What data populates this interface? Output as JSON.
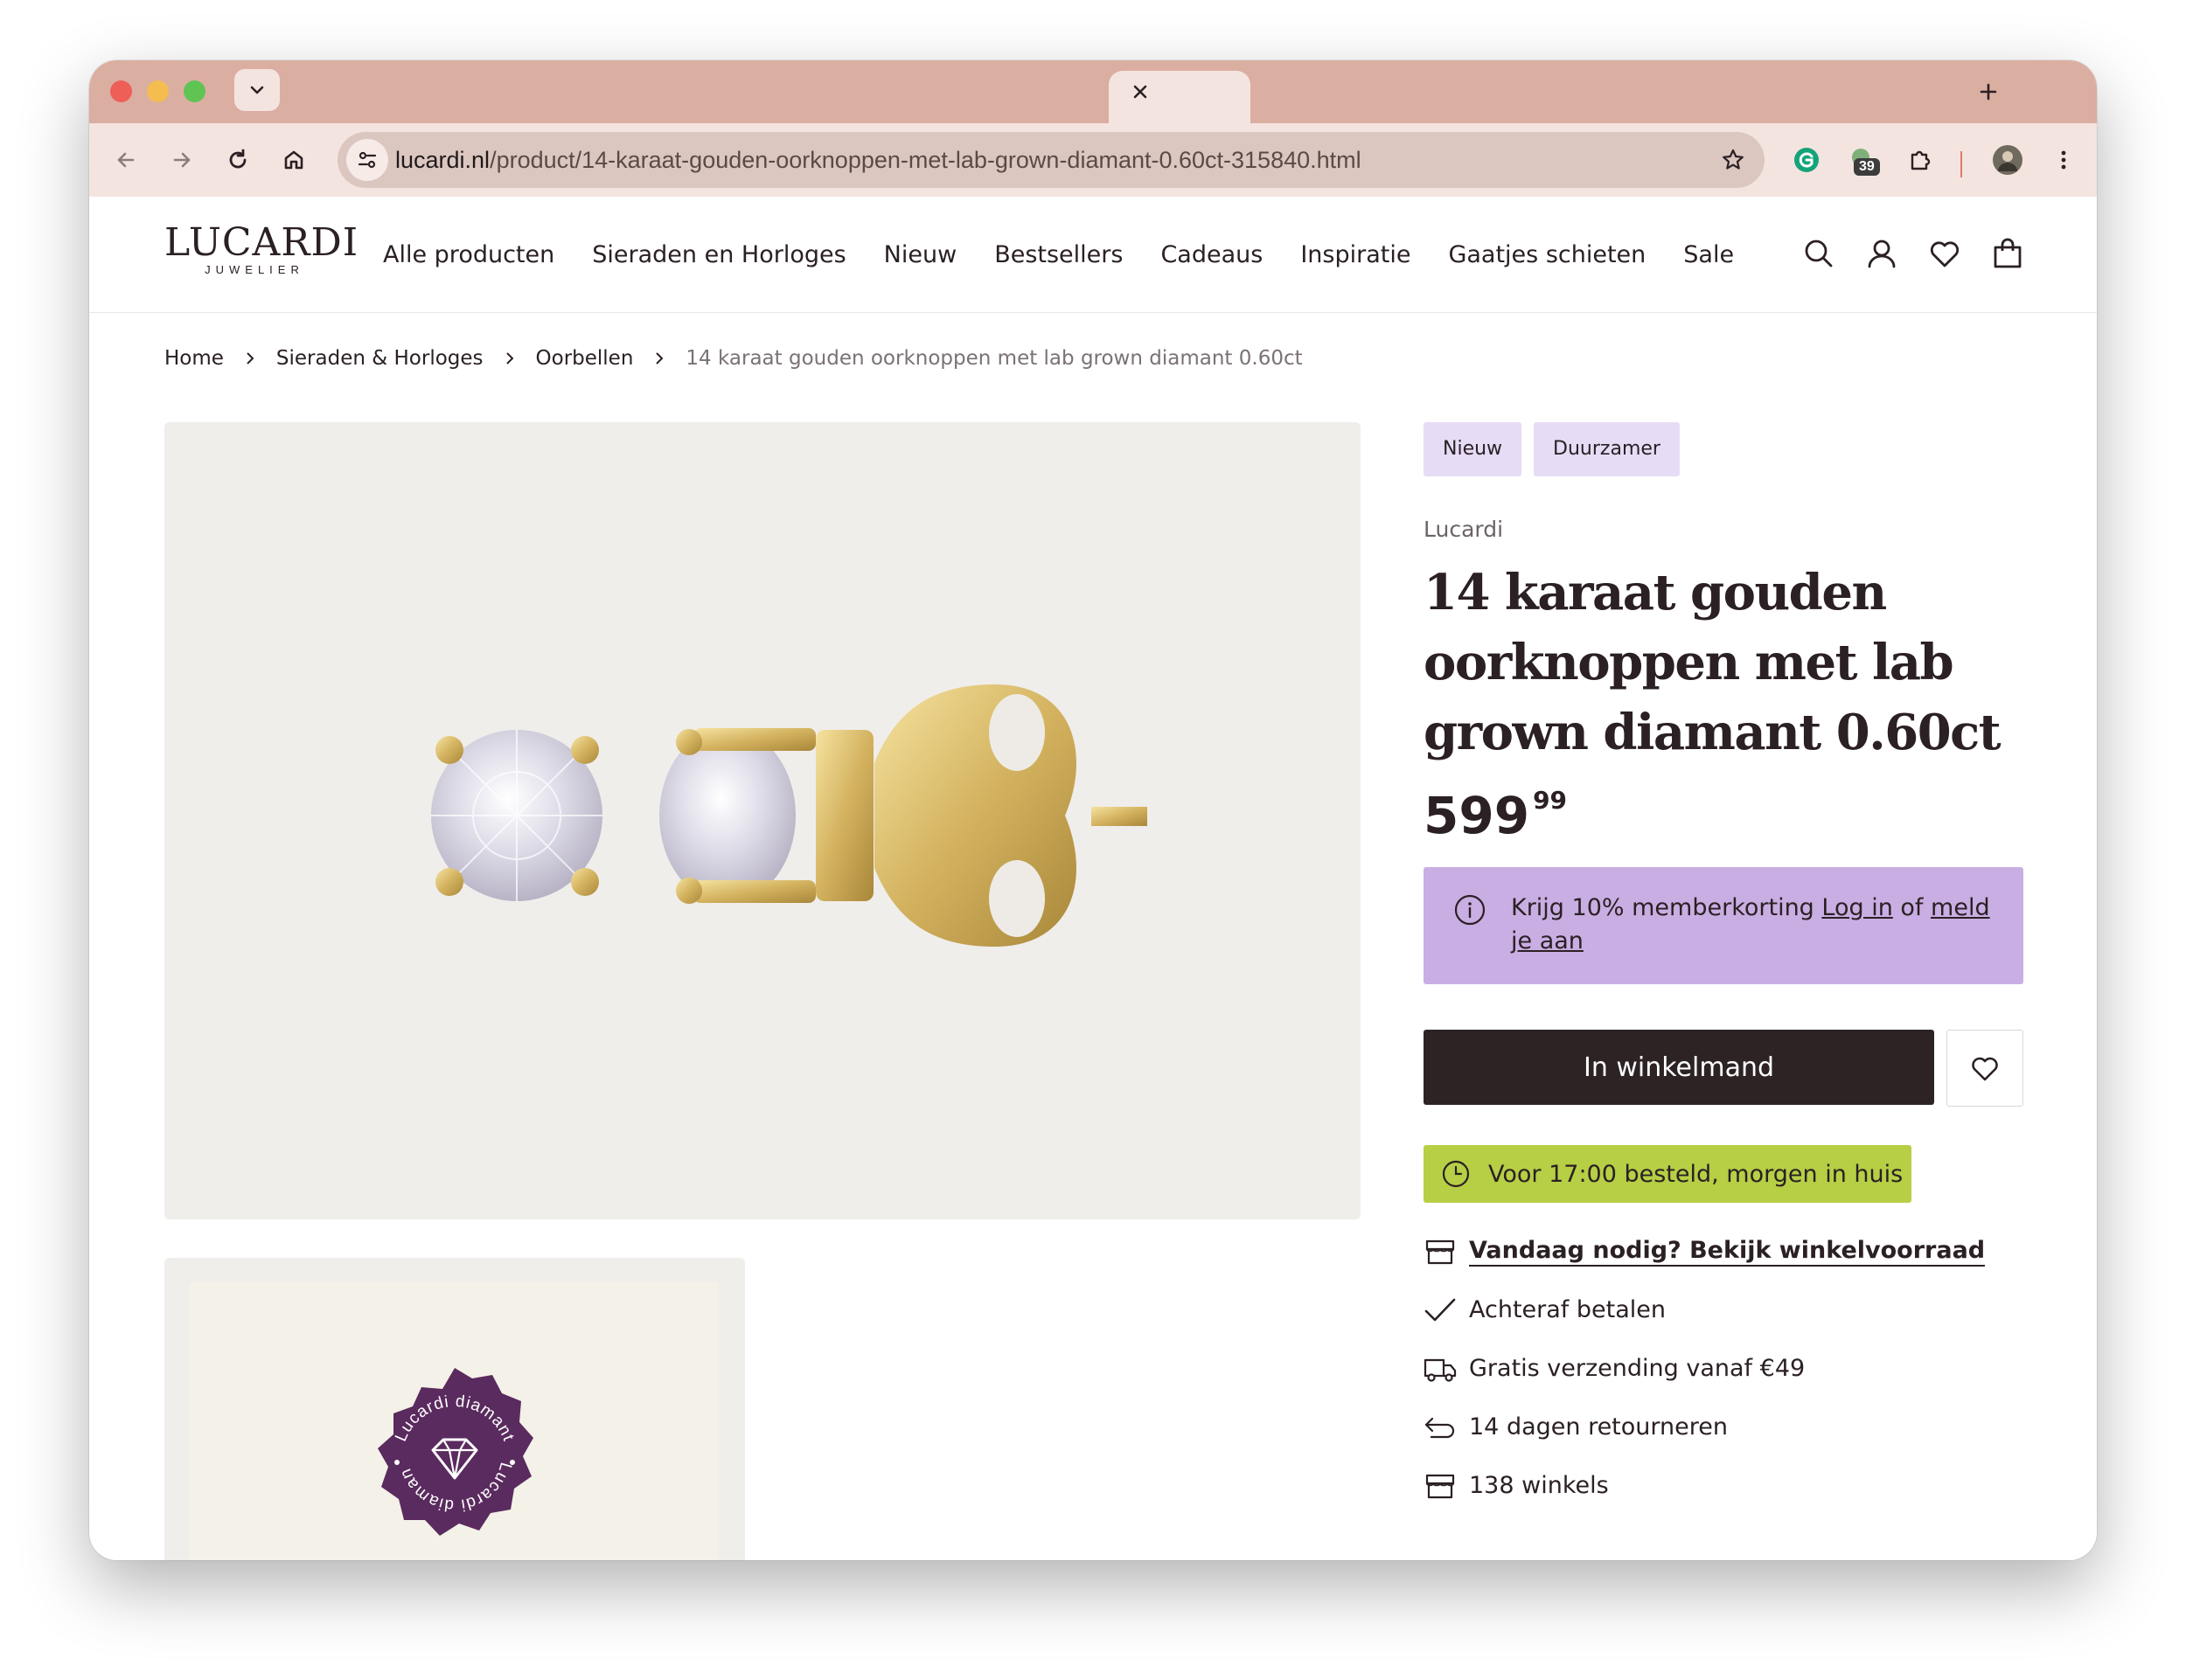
{
  "browser": {
    "url_host": "lucardi.nl",
    "url_path": "/product/14-karaat-gouden-oorknoppen-met-lab-grown-diamant-0.60ct-315840.html",
    "extension_badge": "39"
  },
  "site": {
    "logo_main": "LUCARDI",
    "logo_sub": "JUWELIER",
    "nav": [
      "Alle producten",
      "Sieraden en Horloges",
      "Nieuw",
      "Bestsellers",
      "Cadeaus",
      "Inspiratie",
      "Gaatjes schieten",
      "Sale"
    ]
  },
  "breadcrumb": {
    "home": "Home",
    "cat": "Sieraden & Horloges",
    "sub": "Oorbellen",
    "current": "14 karaat gouden oorknoppen met lab grown diamant 0.60ct"
  },
  "product": {
    "tags": [
      "Nieuw",
      "Duurzamer"
    ],
    "brand": "Lucardi",
    "title": "14 karaat gouden oorknoppen met lab grown diamant 0.60ct",
    "price_main": "599",
    "price_cents": "99",
    "member_text": "Krijg 10% memberkorting ",
    "member_login": "Log in",
    "member_of": " of ",
    "member_signup": "meld je aan",
    "cta_label": "In winkelmand",
    "delivery": "Voor 17:00 besteld, morgen in huis",
    "usps": [
      "Vandaag nodig? Bekijk winkelvoorraad",
      "Achteraf betalen",
      "Gratis verzending vanaf €49",
      "14 dagen retourneren",
      "138 winkels"
    ],
    "seal_text": "Lucardi diamant"
  },
  "colors": {
    "tag_bg": "#e7dcf6",
    "member_bg": "#c9aee3",
    "cta_bg": "#2d2325",
    "delivery_bg": "#b6cf45",
    "seal": "#5a2b5e"
  }
}
